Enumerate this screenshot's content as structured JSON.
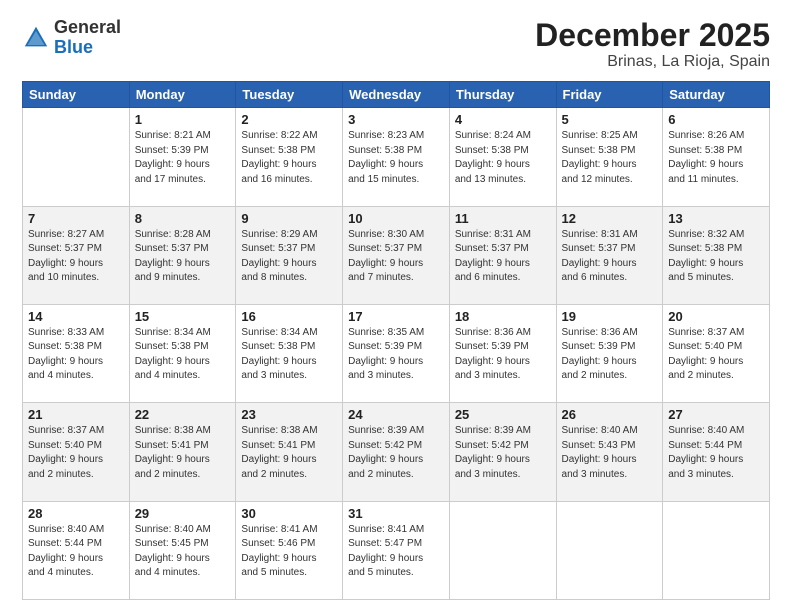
{
  "header": {
    "logo_general": "General",
    "logo_blue": "Blue",
    "title": "December 2025",
    "subtitle": "Brinas, La Rioja, Spain"
  },
  "days_of_week": [
    "Sunday",
    "Monday",
    "Tuesday",
    "Wednesday",
    "Thursday",
    "Friday",
    "Saturday"
  ],
  "weeks": [
    [
      {
        "day": "",
        "info": ""
      },
      {
        "day": "1",
        "info": "Sunrise: 8:21 AM\nSunset: 5:39 PM\nDaylight: 9 hours\nand 17 minutes."
      },
      {
        "day": "2",
        "info": "Sunrise: 8:22 AM\nSunset: 5:38 PM\nDaylight: 9 hours\nand 16 minutes."
      },
      {
        "day": "3",
        "info": "Sunrise: 8:23 AM\nSunset: 5:38 PM\nDaylight: 9 hours\nand 15 minutes."
      },
      {
        "day": "4",
        "info": "Sunrise: 8:24 AM\nSunset: 5:38 PM\nDaylight: 9 hours\nand 13 minutes."
      },
      {
        "day": "5",
        "info": "Sunrise: 8:25 AM\nSunset: 5:38 PM\nDaylight: 9 hours\nand 12 minutes."
      },
      {
        "day": "6",
        "info": "Sunrise: 8:26 AM\nSunset: 5:38 PM\nDaylight: 9 hours\nand 11 minutes."
      }
    ],
    [
      {
        "day": "7",
        "info": "Sunrise: 8:27 AM\nSunset: 5:37 PM\nDaylight: 9 hours\nand 10 minutes."
      },
      {
        "day": "8",
        "info": "Sunrise: 8:28 AM\nSunset: 5:37 PM\nDaylight: 9 hours\nand 9 minutes."
      },
      {
        "day": "9",
        "info": "Sunrise: 8:29 AM\nSunset: 5:37 PM\nDaylight: 9 hours\nand 8 minutes."
      },
      {
        "day": "10",
        "info": "Sunrise: 8:30 AM\nSunset: 5:37 PM\nDaylight: 9 hours\nand 7 minutes."
      },
      {
        "day": "11",
        "info": "Sunrise: 8:31 AM\nSunset: 5:37 PM\nDaylight: 9 hours\nand 6 minutes."
      },
      {
        "day": "12",
        "info": "Sunrise: 8:31 AM\nSunset: 5:37 PM\nDaylight: 9 hours\nand 6 minutes."
      },
      {
        "day": "13",
        "info": "Sunrise: 8:32 AM\nSunset: 5:38 PM\nDaylight: 9 hours\nand 5 minutes."
      }
    ],
    [
      {
        "day": "14",
        "info": "Sunrise: 8:33 AM\nSunset: 5:38 PM\nDaylight: 9 hours\nand 4 minutes."
      },
      {
        "day": "15",
        "info": "Sunrise: 8:34 AM\nSunset: 5:38 PM\nDaylight: 9 hours\nand 4 minutes."
      },
      {
        "day": "16",
        "info": "Sunrise: 8:34 AM\nSunset: 5:38 PM\nDaylight: 9 hours\nand 3 minutes."
      },
      {
        "day": "17",
        "info": "Sunrise: 8:35 AM\nSunset: 5:39 PM\nDaylight: 9 hours\nand 3 minutes."
      },
      {
        "day": "18",
        "info": "Sunrise: 8:36 AM\nSunset: 5:39 PM\nDaylight: 9 hours\nand 3 minutes."
      },
      {
        "day": "19",
        "info": "Sunrise: 8:36 AM\nSunset: 5:39 PM\nDaylight: 9 hours\nand 2 minutes."
      },
      {
        "day": "20",
        "info": "Sunrise: 8:37 AM\nSunset: 5:40 PM\nDaylight: 9 hours\nand 2 minutes."
      }
    ],
    [
      {
        "day": "21",
        "info": "Sunrise: 8:37 AM\nSunset: 5:40 PM\nDaylight: 9 hours\nand 2 minutes."
      },
      {
        "day": "22",
        "info": "Sunrise: 8:38 AM\nSunset: 5:41 PM\nDaylight: 9 hours\nand 2 minutes."
      },
      {
        "day": "23",
        "info": "Sunrise: 8:38 AM\nSunset: 5:41 PM\nDaylight: 9 hours\nand 2 minutes."
      },
      {
        "day": "24",
        "info": "Sunrise: 8:39 AM\nSunset: 5:42 PM\nDaylight: 9 hours\nand 2 minutes."
      },
      {
        "day": "25",
        "info": "Sunrise: 8:39 AM\nSunset: 5:42 PM\nDaylight: 9 hours\nand 3 minutes."
      },
      {
        "day": "26",
        "info": "Sunrise: 8:40 AM\nSunset: 5:43 PM\nDaylight: 9 hours\nand 3 minutes."
      },
      {
        "day": "27",
        "info": "Sunrise: 8:40 AM\nSunset: 5:44 PM\nDaylight: 9 hours\nand 3 minutes."
      }
    ],
    [
      {
        "day": "28",
        "info": "Sunrise: 8:40 AM\nSunset: 5:44 PM\nDaylight: 9 hours\nand 4 minutes."
      },
      {
        "day": "29",
        "info": "Sunrise: 8:40 AM\nSunset: 5:45 PM\nDaylight: 9 hours\nand 4 minutes."
      },
      {
        "day": "30",
        "info": "Sunrise: 8:41 AM\nSunset: 5:46 PM\nDaylight: 9 hours\nand 5 minutes."
      },
      {
        "day": "31",
        "info": "Sunrise: 8:41 AM\nSunset: 5:47 PM\nDaylight: 9 hours\nand 5 minutes."
      },
      {
        "day": "",
        "info": ""
      },
      {
        "day": "",
        "info": ""
      },
      {
        "day": "",
        "info": ""
      }
    ]
  ]
}
